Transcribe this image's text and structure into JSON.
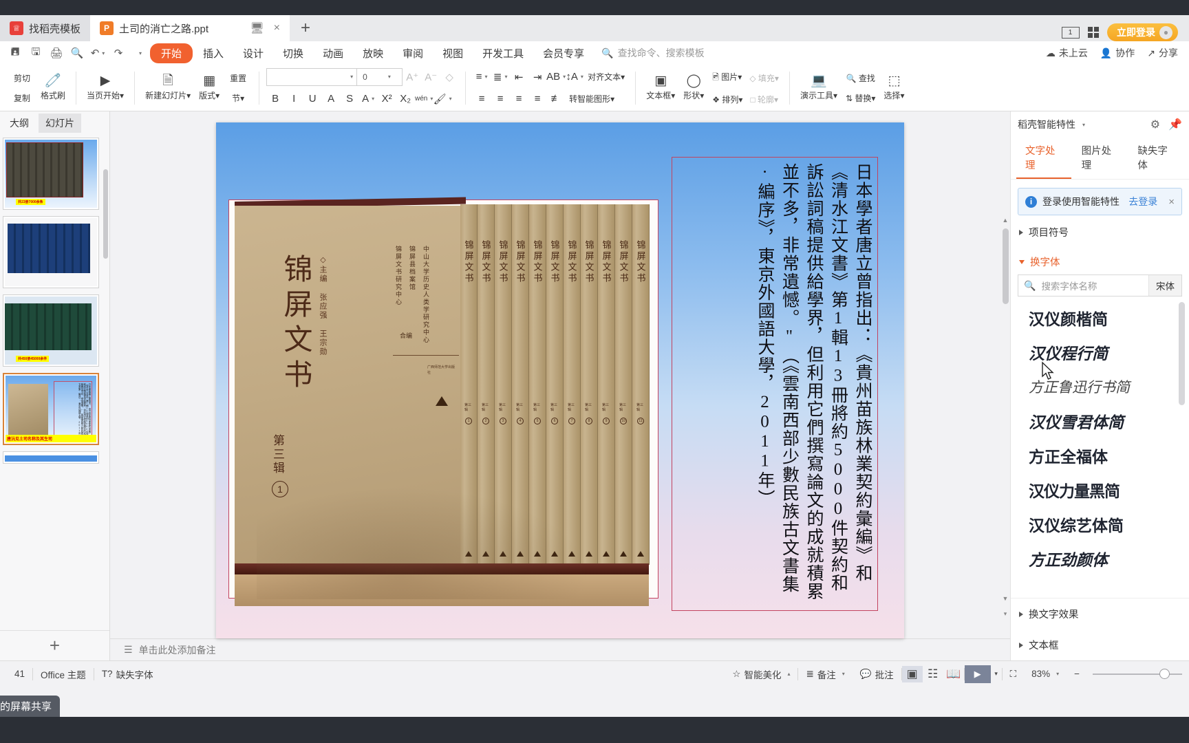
{
  "titlebar": {
    "template_tab": "找稻壳模板",
    "doc_tab": "土司的消亡之路.ppt",
    "new_tab": "+",
    "restore_icon": "restore-window-icon",
    "close_icon": "×",
    "page_count_box": "1",
    "grid_icon": "grid-view-icon",
    "login_label": "立即登录",
    "avatar_icon": "user-avatar-icon"
  },
  "menubar": {
    "quick_access": [
      "save-icon",
      "save-as-icon",
      "print-icon",
      "print-preview-icon",
      "undo-icon",
      "redo-icon",
      "customize-icon"
    ],
    "items": [
      "开始",
      "插入",
      "设计",
      "切换",
      "动画",
      "放映",
      "审阅",
      "视图",
      "开发工具",
      "会员专享"
    ],
    "active": "开始",
    "search_placeholder": "查找命令、搜索模板",
    "cloud_status": "未上云",
    "collaborate": "协作",
    "share": "分享"
  },
  "toolbar": {
    "clipboard": {
      "cut": "剪切",
      "copy": "复制",
      "format_painter": "格式刷"
    },
    "slideshow": {
      "from_current": "当页开始"
    },
    "slides": {
      "new_slide": "新建幻灯片",
      "layout": "版式",
      "section": "节",
      "reset": "重置"
    },
    "font": {
      "name": "",
      "size": "0",
      "grow": "A⁺",
      "shrink": "A⁻",
      "clear": "clear-format-icon",
      "bold": "B",
      "italic": "I",
      "underline": "U",
      "shadow": "A",
      "strike": "S",
      "color": "A",
      "superscript": "X²",
      "subscript": "X₂",
      "pinyin": "wén",
      "highlight": "highlight-icon"
    },
    "paragraph": {
      "bullets": "bullets-icon",
      "numbering": "numbering-icon",
      "decrease_indent": "decrease-indent-icon",
      "increase_indent": "increase-indent-icon",
      "text_direction": "AB",
      "line_spacing": "line-spacing-icon",
      "align_text": "对齐文本",
      "convert_smartart": "转智能图形",
      "align_left": "align-left-icon",
      "align_center": "align-center-icon",
      "align_right": "align-right-icon",
      "justify": "justify-icon",
      "distribute": "distribute-icon"
    },
    "drawing": {
      "textbox": "文本框",
      "shapes": "形状",
      "picture": "图片",
      "arrange": "排列",
      "fill": "填充",
      "outline": "轮廓"
    },
    "tools": {
      "present_tools": "演示工具",
      "find": "查找",
      "replace": "替换",
      "select": "选择"
    }
  },
  "left_panel": {
    "tabs": [
      "大纲",
      "幻灯片"
    ],
    "active_tab": "幻灯片",
    "thumbnails": [
      {
        "caption": "共23册7000余条",
        "kind": "books-brown",
        "selected": false
      },
      {
        "caption": "",
        "kind": "books-blue",
        "selected": false
      },
      {
        "caption": "共450册45000余件",
        "kind": "shelves-green",
        "selected": false
      },
      {
        "caption": "唐沅见土司名称及其生司",
        "kind": "book-text",
        "selected": true
      }
    ],
    "add_slide": "+"
  },
  "slide": {
    "book": {
      "title": "锦屏文书",
      "series": "第三辑",
      "volume": "1",
      "editor": "◇主编  张应强  王宗勋",
      "org_lines": [
        "中山大学历史人类学研究中心",
        "锦屏县档案馆",
        "锦屏文书研究中心"
      ],
      "joint": "合编",
      "publisher": "广西师范大学出版社",
      "spine_title": "锦屏文书",
      "spine_series": "第三辑"
    },
    "vertical_text": "日本學者唐立曾指出：《貴州苗族林業契約彙編》和《清水江文書》第1輯13冊將約5000件契約和訴訟詞稿提供給學界，但利用它們撰寫論文的成就積累並不多，非常遺憾。\"（《雲南西部少數民族古文書集·編序》，東京外國語大學，2011年）"
  },
  "notes": {
    "placeholder": "单击此处添加备注",
    "icon": "add-notes-icon"
  },
  "right_panel": {
    "title": "稻壳智能特性",
    "settings_icon": "gear-icon",
    "pin_icon": "pin-icon",
    "tabs": [
      "文字处理",
      "图片处理",
      "缺失字体"
    ],
    "active_tab": "文字处理",
    "notice": {
      "text": "登录使用智能特性",
      "link": "去登录",
      "close": "×"
    },
    "sections": [
      {
        "label": "项目符号",
        "open": false
      },
      {
        "label": "换字体",
        "open": true
      }
    ],
    "font_search": {
      "placeholder": "搜索字体名称",
      "current": "宋体"
    },
    "fonts": [
      "汉仪颜楷简",
      "汉仪程行简",
      "方正鲁迅行书简",
      "汉仪雪君体简",
      "方正全福体",
      "汉仪力量黑简",
      "汉仪综艺体简",
      "方正劲颜体"
    ],
    "footer_sections": [
      {
        "label": "换文字效果"
      },
      {
        "label": "文本框"
      }
    ]
  },
  "statusbar": {
    "page_info": "41",
    "theme": "Office 主题",
    "missing_font": "缺失字体",
    "beautify": "智能美化",
    "notes": "备注",
    "comments": "批注",
    "view_normal": "normal-view-icon",
    "view_sorter": "slide-sorter-icon",
    "view_reading": "reading-view-icon",
    "play": "play-icon",
    "fit_icon": "fit-slide-icon",
    "zoom": "83%",
    "zoom_out": "−",
    "zoom_in": "+"
  },
  "share_overlay": {
    "tag": "的屏幕共享"
  },
  "colors": {
    "accent": "#f1612f",
    "login": "#f5a623",
    "panel_accent": "#e8622c",
    "textbox_border": "#c2435f",
    "titlebar": "#2b2f36"
  }
}
